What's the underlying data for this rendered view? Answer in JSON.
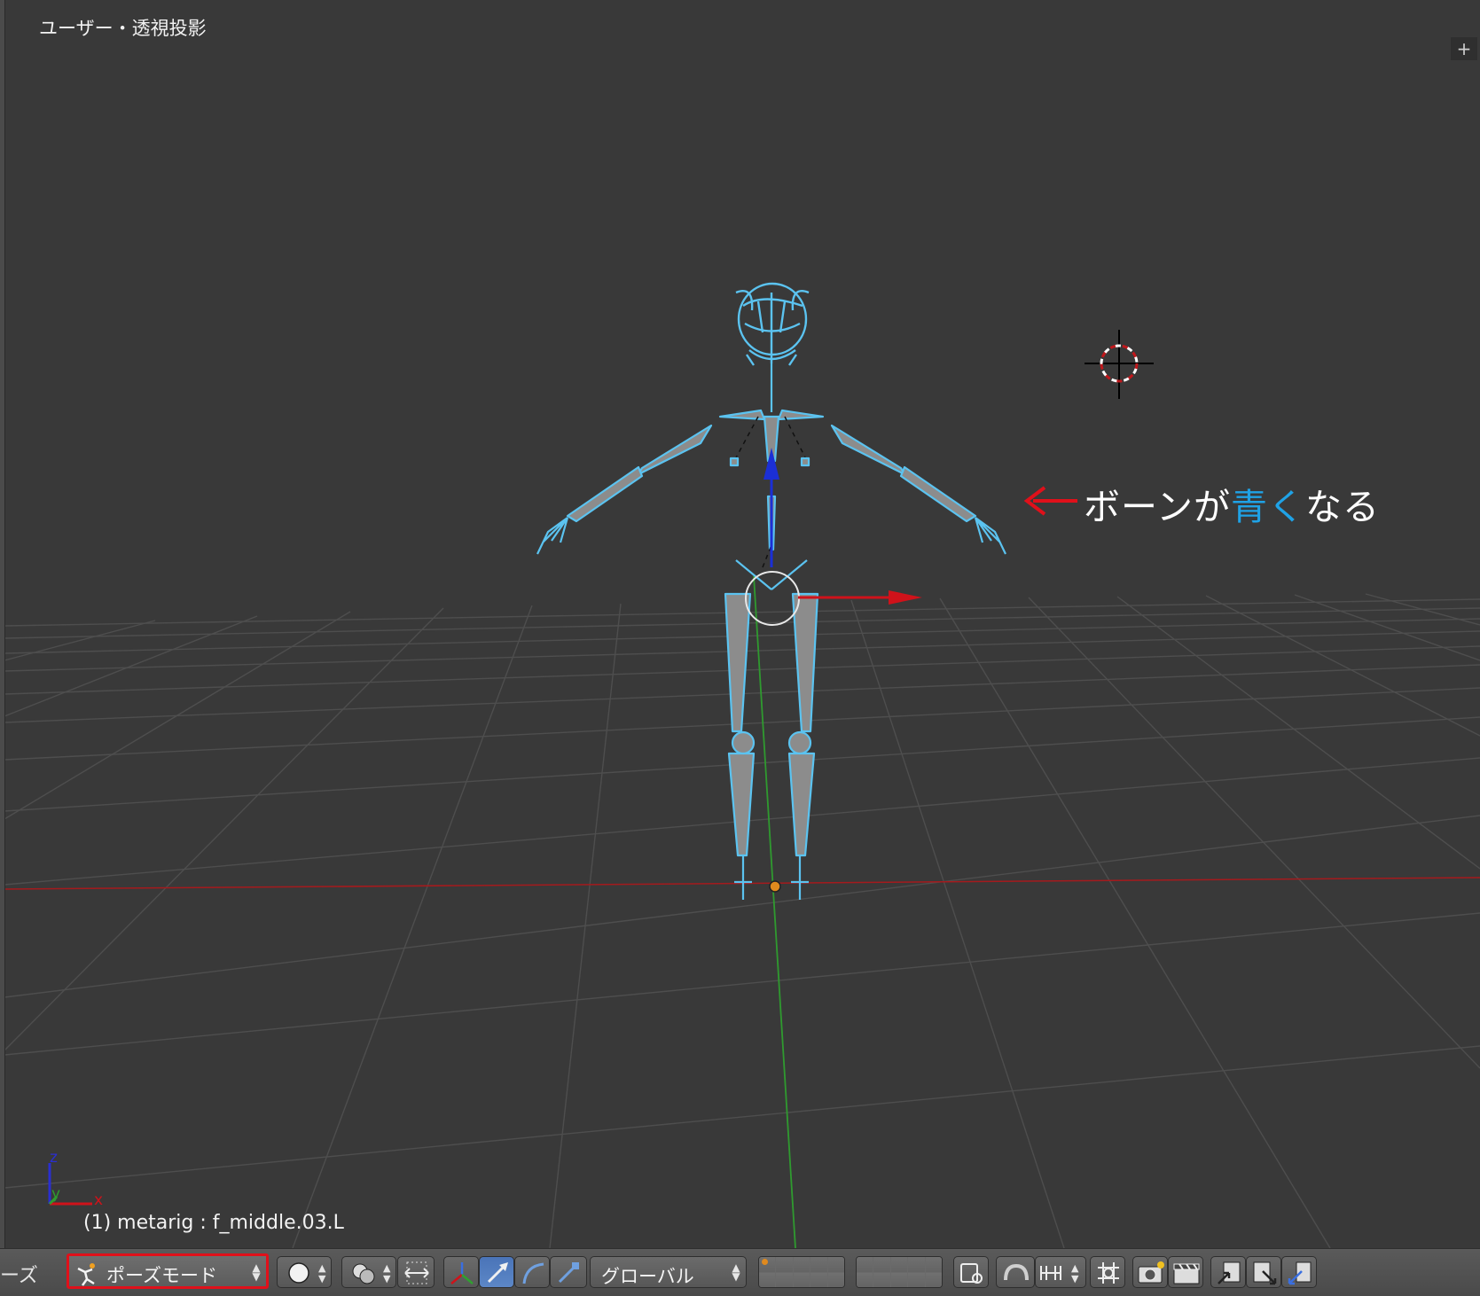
{
  "viewport": {
    "title": "ユーザー・透視投影",
    "status": "(1) metarig : f_middle.03.L",
    "corner_button": "+",
    "axes": {
      "z": "z",
      "y": "y",
      "x": "x"
    }
  },
  "annotation": {
    "prefix": "ボーンが",
    "highlight": "青く",
    "suffix": "なる",
    "arrow_color": "#e0101a",
    "highlight_color": "#1fa2e6"
  },
  "header": {
    "menu_label": "ーズ",
    "mode_select": "ポーズモード",
    "transform_orientation": "グローバル",
    "icons": [
      "pose-mode-icon",
      "viewport-shading-icon",
      "pivot-point-icon",
      "manipulator-toggle-icon",
      "translate-manipulator-icon",
      "rotate-manipulator-icon",
      "scale-manipulator-icon",
      "layer-grid",
      "lock-camera-icon",
      "snap-icon",
      "snap-element-icon",
      "proportional-edit-icon",
      "render-opengl-icon",
      "render-animation-icon",
      "copy-pose-icon",
      "paste-pose-icon",
      "paste-flipped-pose-icon"
    ]
  },
  "colors": {
    "viewport_bg": "#393939",
    "bone_color": "#5bc3f0",
    "x_axis": "#c0171b",
    "y_axis": "#2f9a2f",
    "mode_highlight": "#e0101a"
  }
}
